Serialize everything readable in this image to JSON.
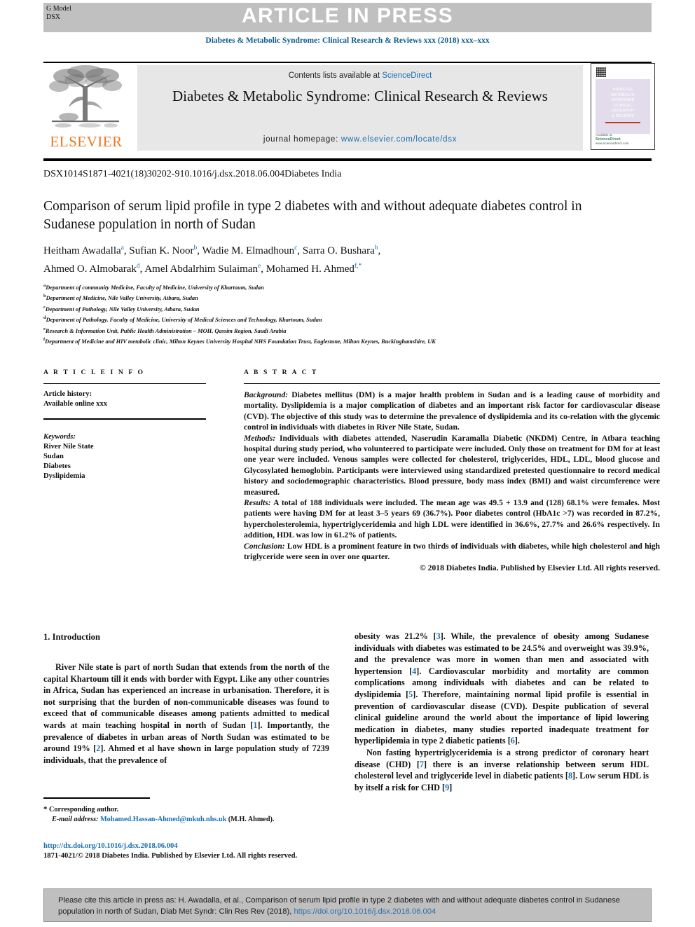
{
  "banner": {
    "g_model": "G Model",
    "g_model_code": "DSX",
    "article_in_press": "ARTICLE IN PRESS"
  },
  "running_head": "Diabetes & Metabolic Syndrome: Clinical Research & Reviews xxx (2018) xxx–xxx",
  "masthead": {
    "contents_prefix": "Contents lists available at ",
    "sciencedirect": "ScienceDirect",
    "journal_title": "Diabetes & Metabolic Syndrome: Clinical Research & Reviews",
    "homepage_label": "journal homepage: ",
    "homepage_url": "www.elsevier.com/locate/dsx",
    "publisher": "ELSEVIER",
    "cover_words_line1": "DIABETES",
    "cover_words_line2": "METABOLIC",
    "cover_words_line3": "SYNDROME",
    "cover_words_line4": "CLINICAL",
    "cover_words_line5": "RESEARCH",
    "cover_words_line6": "& REVIEWS",
    "cover_foot_label": "Available at",
    "cover_foot_brand": "ScienceDirect",
    "cover_foot_sub": "www.sciencedirect.com"
  },
  "doi_line": "DSX1014S1871-4021(18)30202-910.1016/j.dsx.2018.06.004Diabetes India",
  "title": "Comparison of serum lipid profile in type 2 diabetes with and without adequate diabetes control in Sudanese population in north of Sudan",
  "authors_line1": "Heitham Awadalla|a|, Sufian K. Noor|b|, Wadie M. Elmadhoun|c|, Sarra O. Bushara|b|,",
  "authors_line2": "Ahmed O. Almobarak|d|, Amel Abdalrhim Sulaiman|e|, Mohamed H. Ahmed|f,*|",
  "affiliations": [
    {
      "mark": "a",
      "text": "Department of community Medicine, Faculty of Medicine, University of Khartoum, Sudan"
    },
    {
      "mark": "b",
      "text": "Department of Medicine, Nile Valley University, Atbara, Sudan"
    },
    {
      "mark": "c",
      "text": "Department of Pathology, Nile Valley University, Atbara, Sudan"
    },
    {
      "mark": "d",
      "text": "Department of Pathology, Faculty of Medicine, University of Medical Sciences and Technology, Khartoum, Sudan"
    },
    {
      "mark": "e",
      "text": "Research & Information Unit, Public Health Administration – MOH, Qassim Region, Saudi Arabia"
    },
    {
      "mark": "f",
      "text": "Department of Medicine and HIV metabolic clinic, Milton Keynes University Hospital NHS Foundation Trust, Eaglestone, Milton Keynes, Buckinghamshire, UK"
    }
  ],
  "article_info": {
    "heading": "A R T I C L E  I N F O",
    "history_label": "Article history:",
    "history_value": "Available online xxx",
    "keywords_label": "Keywords:",
    "keywords": [
      "River Nile State",
      "Sudan",
      "Diabetes",
      "Dyslipidemia"
    ]
  },
  "abstract": {
    "heading": "A B S T R A C T",
    "background_label": "Background:",
    "background": " Diabetes mellitus (DM) is a major health problem in Sudan and is a leading cause of morbidity and mortality. Dyslipidemia is a major complication of diabetes and an important risk factor for cardiovascular disease (CVD). The objective of this study was to determine the prevalence of dyslipidemia and its co-relation with the glycemic control in individuals with diabetes in River Nile State, Sudan.",
    "methods_label": "Methods:",
    "methods": " Individuals with diabetes attended, Naserudin Karamalla Diabetic (NKDM) Centre, in Atbara teaching hospital during study period, who volunteered to participate were included. Only those on treatment for DM for at least one year were included. Venous samples were collected for cholesterol, triglycerides, HDL, LDL, blood glucose and Glycosylated hemoglobin. Participants were interviewed using standardized pretested questionnaire to record medical history and sociodemographic characteristics. Blood pressure, body mass index (BMI) and waist circumference were measured.",
    "results_label": "Results:",
    "results": " A total of 188 individuals were included. The mean age was 49.5 + 13.9 and (128) 68.1% were females. Most patients were having DM for at least 3–5 years 69 (36.7%). Poor diabetes control (HbA1c >7) was recorded in 87.2%, hypercholesterolemia, hypertriglyceridemia and high LDL were identified in 36.6%, 27.7% and 26.6% respectively. In addition, HDL was low in 61.2% of patients.",
    "conclusion_label": "Conclusion:",
    "conclusion": " Low HDL is a prominent feature in two thirds of individuals with diabetes, while high cholesterol and high triglyceride were seen in over one quarter.",
    "copyright": "© 2018 Diabetes India. Published by Elsevier Ltd. All rights reserved."
  },
  "introduction": {
    "heading": "1. Introduction",
    "para1_a": "River Nile state is part of north Sudan that extends from the north of the capital Khartoum till it ends with border with Egypt. Like any other countries in Africa, Sudan has experienced an increase in urbanisation. Therefore, it is not surprising that the burden of non-communicable diseases was found to exceed that of communicable diseases among patients admitted to medical wards at main teaching hospital in north of Sudan [",
    "ref1": "1",
    "para1_b": "]. Importantly, the prevalence of diabetes in urban areas of North Sudan was estimated to be around 19% [",
    "ref2": "2",
    "para1_c": "]. Ahmed et al have shown in large population study of 7239 individuals, that the prevalence of"
  },
  "right_column": {
    "cont_a": "obesity was 21.2% [",
    "ref3": "3",
    "cont_b": "]. While, the prevalence of obesity among Sudanese individuals with diabetes was estimated to be 24.5% and overweight was 39.9%, and the prevalence was more in women than men and associated with hypertension [",
    "ref4": "4",
    "cont_c": "]. Cardiovascular morbidity and mortality are common complications among individuals with diabetes and can be related to dyslipidemia [",
    "ref5": "5",
    "cont_d": "]. Therefore, maintaining normal lipid profile is essential in prevention of cardiovascular disease (CVD). Despite publication of several clinical guideline around the world about the importance of lipid lowering medication in diabetes, many studies reported inadequate treatment for hyperlipidemia in type 2 diabetic patients [",
    "ref6": "6",
    "cont_e": "].",
    "para2_a": "Non fasting hypertriglyceridemia is a strong predictor of coronary heart disease (CHD) [",
    "ref7": "7",
    "para2_b": "] there is an inverse relationship between serum HDL cholesterol level and triglyceride level in diabetic patients [",
    "ref8": "8",
    "para2_c": "]. Low serum HDL is by itself a risk for CHD [",
    "ref9": "9",
    "para2_d": "]"
  },
  "footnote": {
    "star": "*",
    "corresponding": "Corresponding author.",
    "email_label": "E-mail address:",
    "email": "Mohamed.Hassan-Ahmed@mkuh.nhs.uk",
    "email_suffix": " (M.H. Ahmed)."
  },
  "bottom": {
    "doi_url": "http://dx.doi.org/10.1016/j.dsx.2018.06.004",
    "issn_line": "1871-4021/© 2018 Diabetes India. Published by Elsevier Ltd. All rights reserved."
  },
  "citation_box": {
    "text_a": "Please cite this article in press as: H. Awadalla, et al., Comparison of serum lipid profile in type 2 diabetes with and without adequate diabetes control in Sudanese population in north of Sudan, Diab Met Syndr: Clin Res Rev (2018), ",
    "link": "https://doi.org/10.1016/j.dsx.2018.06.004"
  },
  "colors": {
    "journal_blue": "#0d5c8c",
    "link_blue": "#1a6fad",
    "elsevier_orange": "#e87722",
    "banner_grey": "#c0c0c0",
    "panel_grey": "#e7e7e7",
    "cite_grey": "#bfbfbf"
  }
}
